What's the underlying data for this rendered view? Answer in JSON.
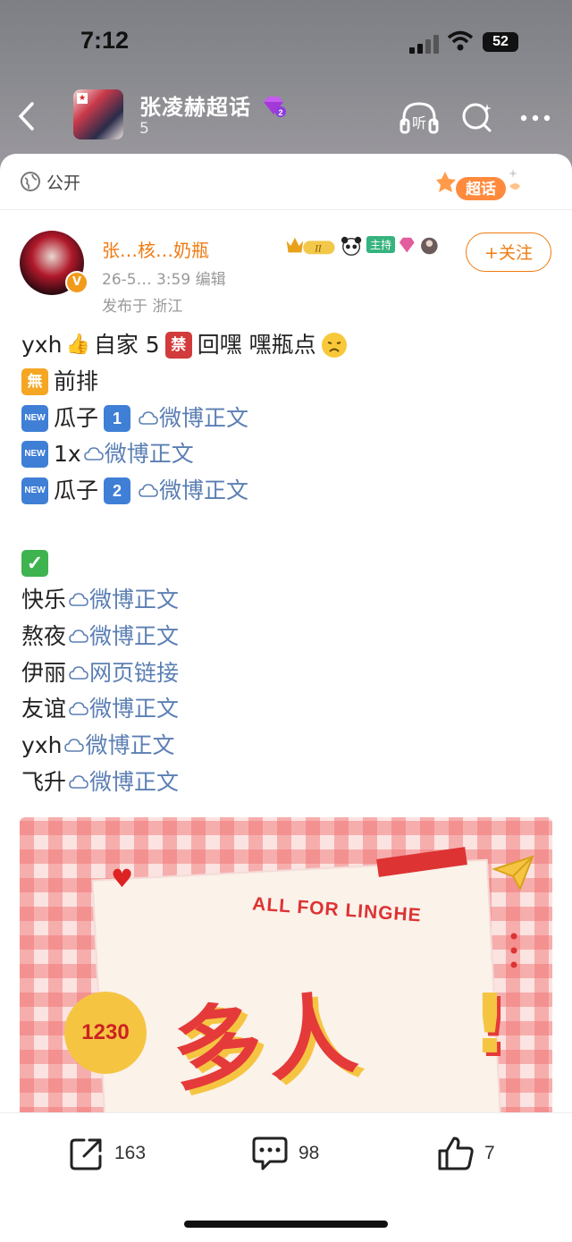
{
  "status_bar": {
    "time": "7:12",
    "battery": "52"
  },
  "nav": {
    "topic_name": "张凌赫超话",
    "topic_count": "5",
    "listen_label": "听",
    "level": "2"
  },
  "card": {
    "visibility": "公开",
    "super_badge": "超话"
  },
  "author": {
    "name": "张…核…奶瓶",
    "host_tag": "主持",
    "time": "26-5… 3:59",
    "edited": "编辑",
    "location": "发布于 浙江",
    "follow_label": "+关注"
  },
  "content": {
    "lines": [
      {
        "text_a": "yxh",
        "text_b": "自家 5",
        "text_c": "回嘿 嘿瓶点"
      },
      {
        "badge": "無",
        "text": "前排"
      },
      {
        "badge": "NEW",
        "text": "瓜子",
        "num": "1",
        "link": "微博正文"
      },
      {
        "badge": "NEW",
        "text": "1x",
        "link": "微博正文"
      },
      {
        "badge": "NEW",
        "text": "瓜子",
        "num": "2",
        "link": "微博正文"
      }
    ],
    "done_items": [
      {
        "text": "快乐",
        "link": "微博正文"
      },
      {
        "text": "熬夜",
        "link": "微博正文"
      },
      {
        "text": "伊丽",
        "link": "网页链接"
      },
      {
        "text": "友谊",
        "link": "微博正文"
      },
      {
        "text": "yxh",
        "link": "微博正文"
      },
      {
        "text": "飞升",
        "link": "微博正文"
      }
    ],
    "image": {
      "caption": "ALL FOR LINGHE",
      "title": "多人",
      "date": "1230",
      "exclam": "!"
    }
  },
  "actions": {
    "repost_count": "163",
    "comment_count": "98",
    "like_count": "7"
  },
  "colors": {
    "accent": "#f07a10",
    "link": "#5b7fb3",
    "new_badge": "#3f7fd6"
  }
}
